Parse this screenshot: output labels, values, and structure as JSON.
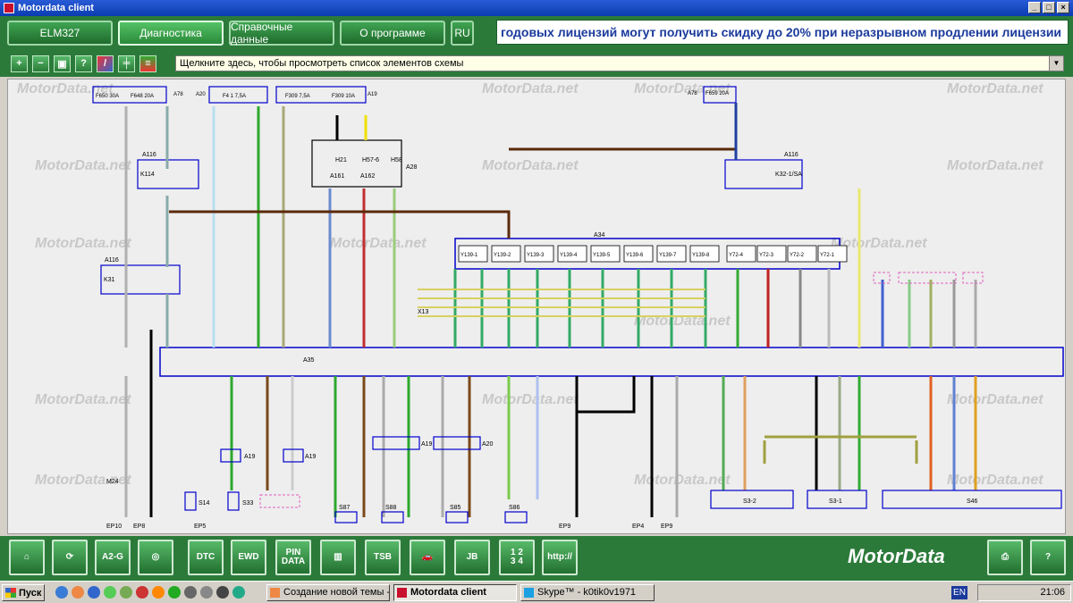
{
  "window": {
    "title": "Motordata client"
  },
  "nav": {
    "buttons": [
      "ELM327",
      "Диагностика",
      "Справочные данные",
      "О программе",
      "RU"
    ],
    "ticker": "годовых лицензий могут получить скидку до 20% при неразрывном продлении лицензии"
  },
  "toolbar": {
    "tools": [
      "zoom-in",
      "zoom-out",
      "fit",
      "help",
      "colors",
      "grid",
      "layers"
    ],
    "element_list_placeholder": "Щелкните здесь, чтобы просмотреть список элементов схемы"
  },
  "diagram": {
    "watermark": "MotorData.net",
    "fuses": [
      "F650 30A",
      "F648 20A",
      "F4 1 7,5A",
      "F309 7,5A",
      "F309 10A",
      "F659 20A"
    ],
    "connectors": [
      "A78",
      "A20",
      "A19",
      "A116",
      "A28",
      "A34",
      "A35",
      "X13"
    ],
    "relays": [
      "K114",
      "K31",
      "K32-1/SA"
    ],
    "lamps": [
      "H21",
      "H57-6",
      "H58"
    ],
    "modules": [
      "A161",
      "A162"
    ],
    "solenoids": [
      "Y139-1",
      "Y139-2",
      "Y139-3",
      "Y139-4",
      "Y139-5",
      "Y139-6",
      "Y139-7",
      "Y139-8",
      "Y72-4",
      "Y72-3",
      "Y72-2",
      "Y72-1"
    ],
    "switches": [
      "S14",
      "S33",
      "S87",
      "S88",
      "S85",
      "S86",
      "S3-2",
      "S3-1",
      "S46"
    ],
    "grounds": [
      "EP10",
      "EP8",
      "EP5",
      "EP9",
      "EP4",
      "EP9"
    ],
    "misc": [
      "M24",
      "A116"
    ]
  },
  "bottom": {
    "icons": [
      "Home",
      "Diag",
      "A2-G",
      "Speedo",
      "DTC",
      "EWD",
      "PIN DATA",
      "Tester",
      "TSB",
      "Car",
      "JB",
      "1234",
      "http://"
    ],
    "brand": "MotorData",
    "right_icons": [
      "Print",
      "Help"
    ]
  },
  "taskbar": {
    "start": "Пуск",
    "tasks": [
      "Создание новой темы -...",
      "Motordata client",
      "Skype™ - k0tik0v1971"
    ],
    "lang": "EN",
    "clock": "21:06"
  },
  "colors": {
    "green": "#2c7a3a",
    "accent_blue": "#1a3a9c",
    "connector_blue": "#0000cc"
  }
}
